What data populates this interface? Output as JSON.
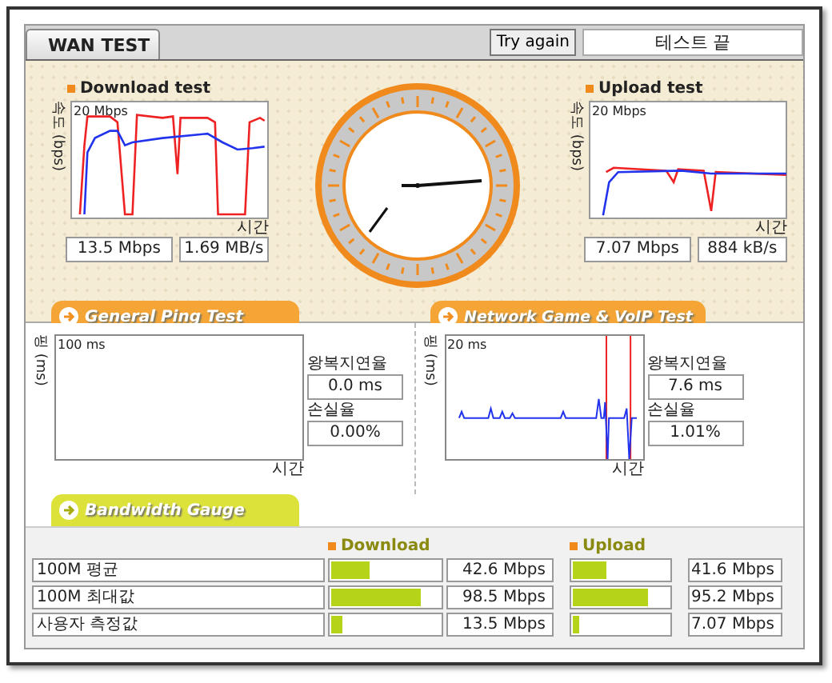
{
  "tab": "WAN TEST",
  "try_again": "Try again",
  "status": "테스트 끝",
  "throughput": [
    {
      "kind": "download",
      "title": "Download test",
      "y_axis": "속도 (bps)",
      "scale": "20 Mbps",
      "x_axis": "시간",
      "rate": "13.5 Mbps",
      "bytes": "1.69 MB/s"
    },
    {
      "kind": "upload",
      "title": "Upload test",
      "y_axis": "속도 (bps)",
      "scale": "20 Mbps",
      "x_axis": "시간",
      "rate": "7.07 Mbps",
      "bytes": "884 kB/s"
    }
  ],
  "latency_tests": [
    {
      "kind": "ping",
      "heading": "General Ping Test",
      "y_axis": "핑 (ms)",
      "scale": "100 ms",
      "x_axis": "시간",
      "latency_label": "왕복지연율",
      "latency": "0.0 ms",
      "loss_label": "손실율",
      "loss": "0.00%"
    },
    {
      "kind": "game",
      "heading": "Network Game & VoIP Test",
      "y_axis": "핑 (ms)",
      "scale": "20 ms",
      "x_axis": "시간",
      "latency_label": "왕복지연율",
      "latency": "7.6 ms",
      "loss_label": "손실율",
      "loss": "1.01%"
    }
  ],
  "bandwidth": {
    "heading": "Bandwidth Gauge",
    "download_label": "Download",
    "upload_label": "Upload",
    "rows": [
      {
        "label": "100M 평균",
        "download": {
          "level": 0.36,
          "value": "42.6 Mbps"
        },
        "upload": {
          "level": 0.35,
          "value": "41.6 Mbps"
        }
      },
      {
        "label": "100M 최대값",
        "download": {
          "level": 0.82,
          "value": "98.5 Mbps"
        },
        "upload": {
          "level": 0.79,
          "value": "95.2 Mbps"
        }
      },
      {
        "label": "사용자 측정값",
        "download": {
          "level": 0.11,
          "value": "13.5 Mbps"
        },
        "upload": {
          "level": 0.06,
          "value": "7.07 Mbps"
        }
      }
    ]
  }
}
